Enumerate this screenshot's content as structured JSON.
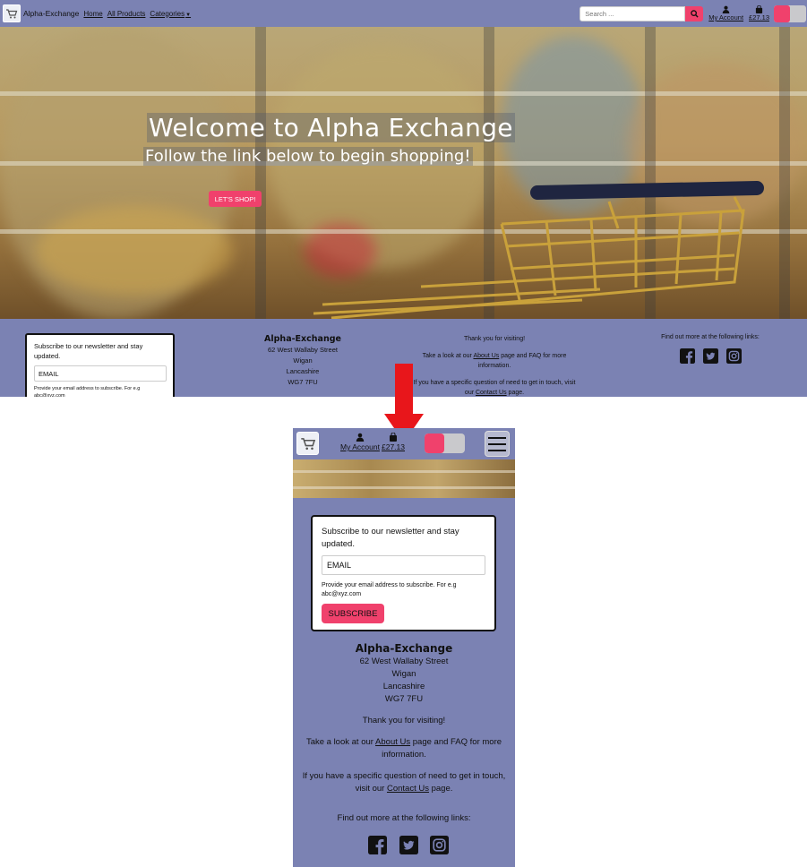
{
  "desktop": {
    "navbar": {
      "brand": "Alpha-Exchange",
      "links": [
        "Home",
        "All Products",
        "Categories"
      ],
      "search_placeholder": "Search ...",
      "account_label": "My Account",
      "bag_total": "£27.13"
    },
    "hero": {
      "title": "Welcome to Alpha Exchange",
      "subtitle": "Follow the link below to begin shopping!",
      "button": "LET'S SHOP!"
    },
    "footer": {
      "newsletter_text": "Subscribe to our newsletter and stay updated.",
      "email_value": "EMAIL",
      "help_text": "Provide your email address to subscribe. For e.g abc@xyz.com",
      "company": "Alpha-Exchange",
      "address": [
        "62 West Wallaby Street",
        "Wigan",
        "Lancashire",
        "WG7 7FU"
      ],
      "thanks": "Thank you for visiting!",
      "about_pre": "Take a look at our ",
      "about_link": "About Us",
      "about_post": " page and FAQ for more information.",
      "contact_pre": "If you have a specific question of need to get in touch, visit our ",
      "contact_link": "Contact Us",
      "contact_post": " page.",
      "links_title": "Find out more at the following links:"
    }
  },
  "mobile": {
    "navbar": {
      "account_label": "My Account",
      "bag_total": "£27.13"
    },
    "footer": {
      "newsletter_text": "Subscribe to our newsletter and stay updated.",
      "email_value": "EMAIL",
      "help_text": "Provide your email address to subscribe. For e.g abc@xyz.com",
      "subscribe_button": "SUBSCRIBE",
      "company": "Alpha-Exchange",
      "address": [
        "62 West Wallaby Street",
        "Wigan",
        "Lancashire",
        "WG7 7FU"
      ],
      "thanks": "Thank you for visiting!",
      "about_pre": "Take a look at our ",
      "about_link": "About Us",
      "about_post": " page and FAQ for more information.",
      "contact_pre": "If you have a specific question of need to get in touch, visit our ",
      "contact_link": "Contact Us",
      "contact_post": " page.",
      "links_title": "Find out more at the following links:"
    }
  },
  "colors": {
    "navbar_bg": "#7b82b3",
    "accent": "#f0416c",
    "arrow": "#e8161b"
  },
  "icons": [
    "cart-logo-icon",
    "search-icon",
    "user-icon",
    "shopping-bag-icon",
    "facebook-icon",
    "twitter-icon",
    "instagram-icon",
    "hamburger-icon",
    "down-arrow-icon"
  ]
}
